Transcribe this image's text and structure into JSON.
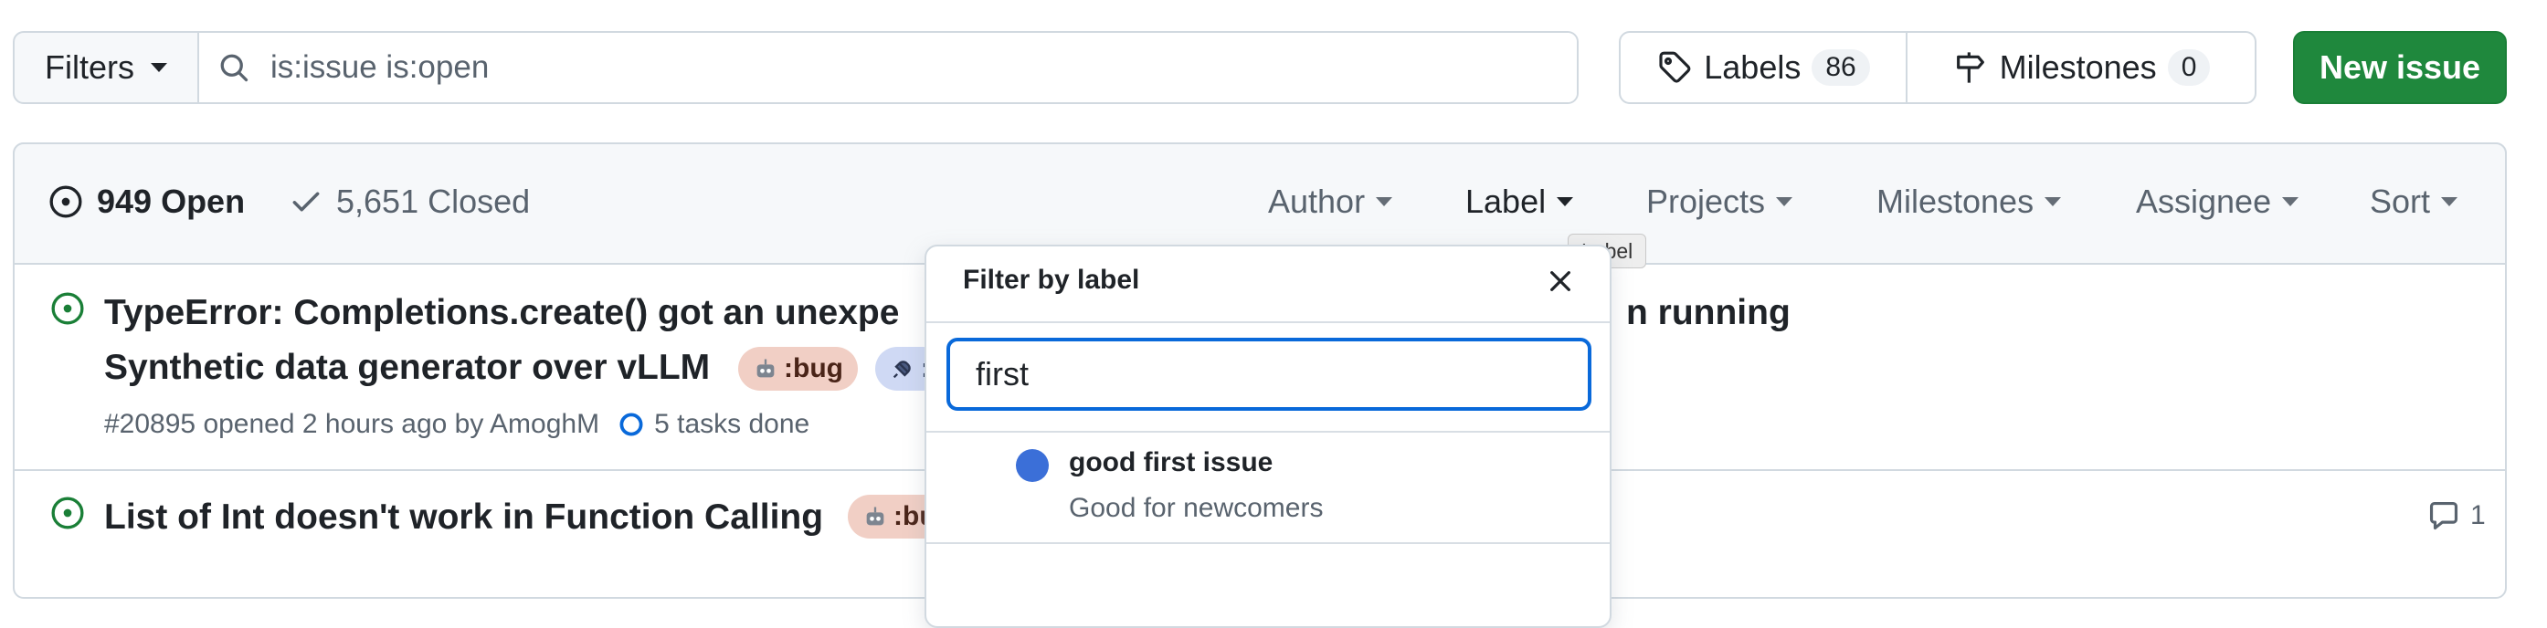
{
  "toolbar": {
    "filters_label": "Filters",
    "search_value": "is:issue is:open",
    "labels_label": "Labels",
    "labels_count": "86",
    "milestones_label": "Milestones",
    "milestones_count": "0",
    "new_issue_label": "New issue"
  },
  "list_header": {
    "open_label": "949 Open",
    "closed_label": "5,651 Closed",
    "filters": [
      "Author",
      "Label",
      "Projects",
      "Milestones",
      "Assignee",
      "Sort"
    ]
  },
  "tooltip": "Label",
  "issues": [
    {
      "title_line1": "TypeError: Completions.create() got an unexpe",
      "title_line1_end": "n running",
      "title_line2": "Synthetic data generator over vLLM",
      "labels": [
        ":bug",
        ":"
      ],
      "meta": "#20895 opened 2 hours ago by AmoghM",
      "tasks": "5 tasks done"
    },
    {
      "title": "List of Int doesn't work in Function Calling",
      "labels": [
        ":bu"
      ],
      "comments": "1"
    }
  ],
  "label_dropdown": {
    "title": "Filter by label",
    "query": "first",
    "items": [
      {
        "name": "good first issue",
        "description": "Good for newcomers",
        "color": "#3b6fd8"
      }
    ]
  },
  "colors": {
    "accent_blue": "#0969da",
    "open_green": "#1a7f37",
    "new_issue_bg": "#1f883d"
  }
}
